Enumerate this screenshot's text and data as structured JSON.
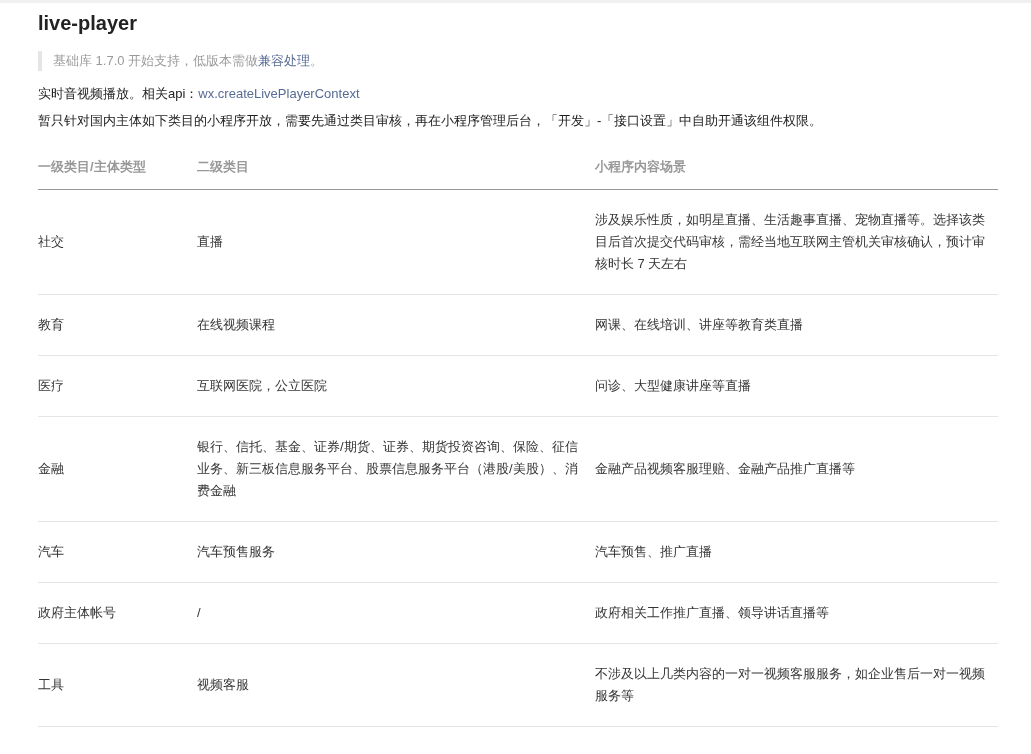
{
  "title": "live-player",
  "notice": {
    "text": "基础库 1.7.0 开始支持，低版本需做",
    "link": "兼容处理",
    "suffix": "。"
  },
  "description": {
    "text": "实时音视频播放。相关api：",
    "link": "wx.createLivePlayerContext"
  },
  "restriction": "暂只针对国内主体如下类目的小程序开放，需要先通过类目审核，再在小程序管理后台，「开发」-「接口设置」中自助开通该组件权限。",
  "table": {
    "columns": [
      "一级类目/主体类型",
      "二级类目",
      "小程序内容场景"
    ],
    "rows": [
      [
        "社交",
        "直播",
        "涉及娱乐性质，如明星直播、生活趣事直播、宠物直播等。选择该类目后首次提交代码审核，需经当地互联网主管机关审核确认，预计审核时长 7 天左右"
      ],
      [
        "教育",
        "在线视频课程",
        "网课、在线培训、讲座等教育类直播"
      ],
      [
        "医疗",
        "互联网医院，公立医院",
        "问诊、大型健康讲座等直播"
      ],
      [
        "金融",
        "银行、信托、基金、证券/期货、证券、期货投资咨询、保险、征信业务、新三板信息服务平台、股票信息服务平台（港股/美股）、消费金融",
        "金融产品视频客服理赔、金融产品推广直播等"
      ],
      [
        "汽车",
        "汽车预售服务",
        "汽车预售、推广直播"
      ],
      [
        "政府主体帐号",
        "/",
        "政府相关工作推广直播、领导讲话直播等"
      ],
      [
        "工具",
        "视频客服",
        "不涉及以上几类内容的一对一视频客服服务，如企业售后一对一视频服务等"
      ]
    ]
  }
}
